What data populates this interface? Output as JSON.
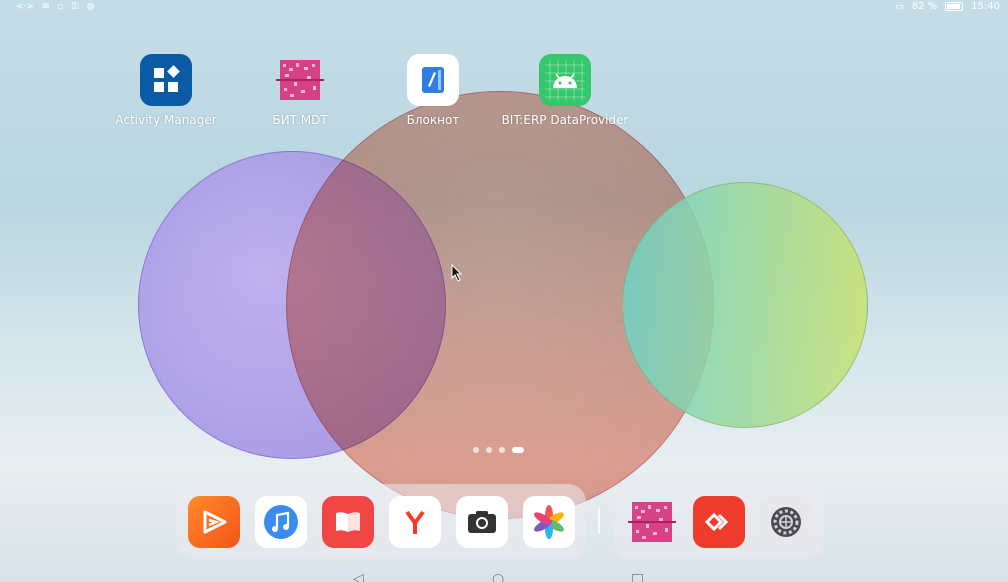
{
  "statusbar": {
    "battery_text": "82 %",
    "time": "15:40"
  },
  "apps": [
    {
      "label": "Activity Manager",
      "icon": "activity-manager-icon",
      "color": "#0b5aa6"
    },
    {
      "label": "БИТ.MDT",
      "icon": "barcode-scan-icon",
      "color": "#d6307a"
    },
    {
      "label": "Блокнот",
      "icon": "notepad-icon",
      "color": "#2f7de1"
    },
    {
      "label": "BIT:ERP DataProvider",
      "icon": "android-icon",
      "color": "#34c76b"
    }
  ],
  "pages": {
    "count": 4,
    "active": 3
  },
  "dock": {
    "left": [
      {
        "icon": "video-player-icon",
        "color": "#f56a1f"
      },
      {
        "icon": "music-icon",
        "color": "#3a8cf0"
      },
      {
        "icon": "books-icon",
        "color": "#f04646"
      },
      {
        "icon": "yandex-browser-icon",
        "color": "#f43a2a"
      },
      {
        "icon": "camera-icon",
        "color": "#333333"
      },
      {
        "icon": "gallery-icon",
        "color": "#ff9800"
      }
    ],
    "right": [
      {
        "icon": "barcode-scan-icon",
        "color": "#d6307a"
      },
      {
        "icon": "anydesk-icon",
        "color": "#ef3b2c"
      },
      {
        "icon": "settings-gear-icon",
        "color": "#4a4a52"
      }
    ]
  }
}
